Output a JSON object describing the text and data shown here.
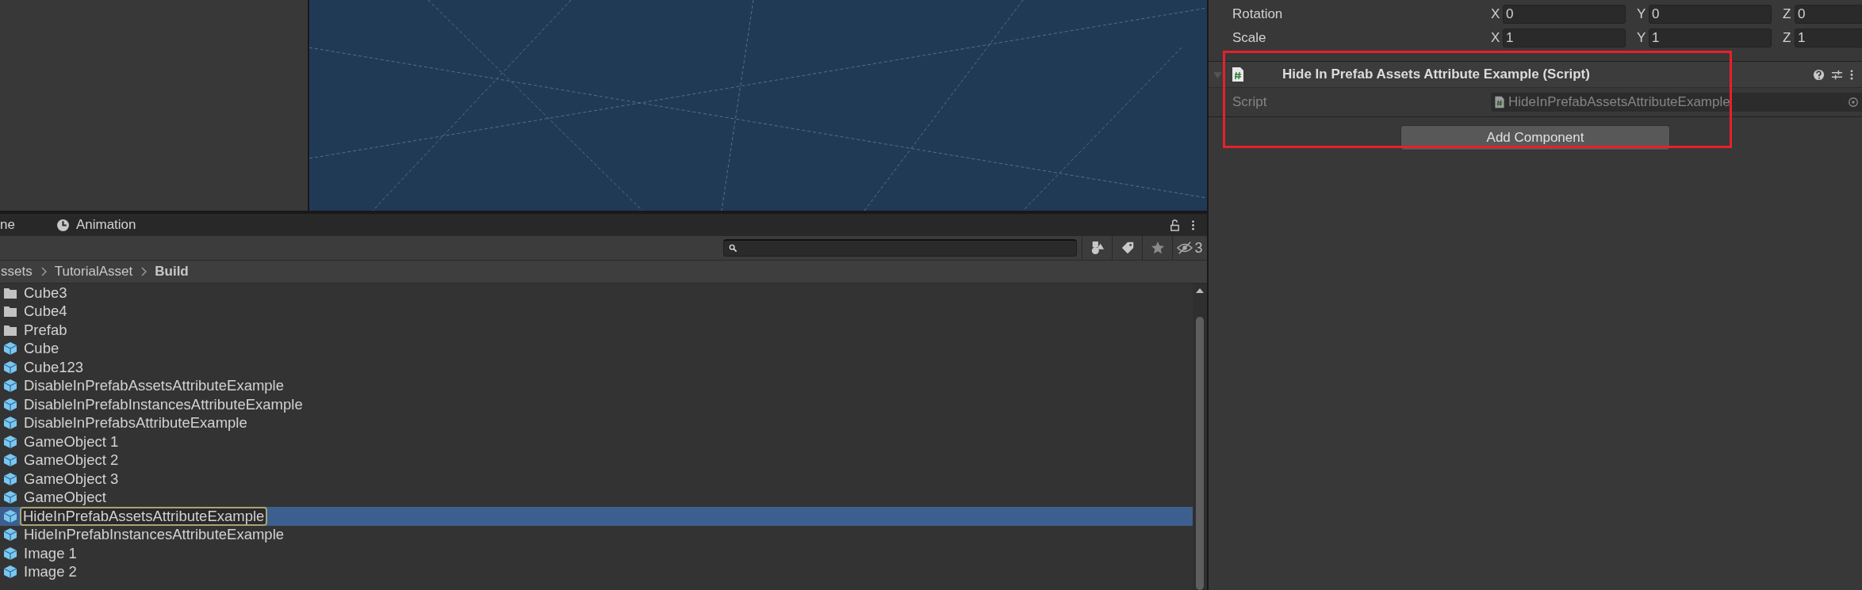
{
  "project_panel": {
    "tabs": [
      {
        "label": "ne"
      },
      {
        "label": "Animation"
      }
    ],
    "hidden_count": "3",
    "breadcrumb": [
      "ssets",
      "TutorialAsset",
      "Build"
    ],
    "items": [
      {
        "name": "Cube3",
        "kind": "folder",
        "selected": false
      },
      {
        "name": "Cube4",
        "kind": "folder",
        "selected": false
      },
      {
        "name": "Prefab",
        "kind": "folder",
        "selected": false
      },
      {
        "name": "Cube",
        "kind": "prefab",
        "selected": false
      },
      {
        "name": "Cube123",
        "kind": "prefab",
        "selected": false
      },
      {
        "name": "DisableInPrefabAssetsAttributeExample",
        "kind": "prefab",
        "selected": false
      },
      {
        "name": "DisableInPrefabInstancesAttributeExample",
        "kind": "prefab",
        "selected": false
      },
      {
        "name": "DisableInPrefabsAttributeExample",
        "kind": "prefab",
        "selected": false
      },
      {
        "name": "GameObject 1",
        "kind": "prefab",
        "selected": false
      },
      {
        "name": "GameObject 2",
        "kind": "prefab",
        "selected": false
      },
      {
        "name": "GameObject 3",
        "kind": "prefab",
        "selected": false
      },
      {
        "name": "GameObject",
        "kind": "prefab",
        "selected": false
      },
      {
        "name": "HideInPrefabAssetsAttributeExample",
        "kind": "prefab",
        "selected": true
      },
      {
        "name": "HideInPrefabInstancesAttributeExample",
        "kind": "prefab",
        "selected": false
      },
      {
        "name": "Image 1",
        "kind": "prefab",
        "selected": false
      },
      {
        "name": "Image 2",
        "kind": "prefab",
        "selected": false
      }
    ]
  },
  "inspector": {
    "transform_rows": [
      {
        "label": "Rotation",
        "fields": [
          {
            "axis": "X",
            "value": "0"
          },
          {
            "axis": "Y",
            "value": "0"
          },
          {
            "axis": "Z",
            "value": "0"
          }
        ]
      },
      {
        "label": "Scale",
        "fields": [
          {
            "axis": "X",
            "value": "1"
          },
          {
            "axis": "Y",
            "value": "1"
          },
          {
            "axis": "Z",
            "value": "1"
          }
        ]
      }
    ],
    "component": {
      "title": "Hide In Prefab Assets Attribute Example (Script)",
      "expanded": true,
      "script_field": {
        "label": "Script",
        "value": "HideInPrefabAssetsAttributeExample",
        "disabled": true
      }
    },
    "add_button": "Add Component"
  }
}
